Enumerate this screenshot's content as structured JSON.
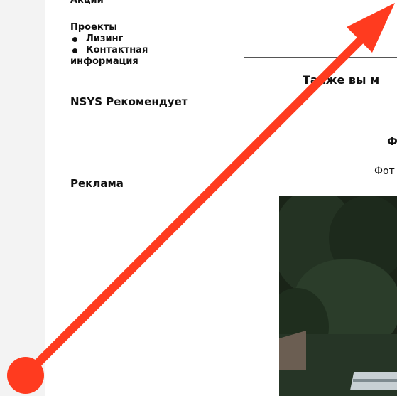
{
  "sidebar": {
    "top_cut_label": "Акции",
    "projects_heading": "Проекты",
    "projects": [
      "Лизинг",
      "Контактная информация"
    ],
    "recommend_heading": "NSYS Рекомендует",
    "ads_heading": "Реклама"
  },
  "main": {
    "also_heading": "Также вы м",
    "photo_title": "Ф",
    "photo_caption": "Фот"
  },
  "annotation": {
    "arrow_color": "#ff3b1f"
  }
}
